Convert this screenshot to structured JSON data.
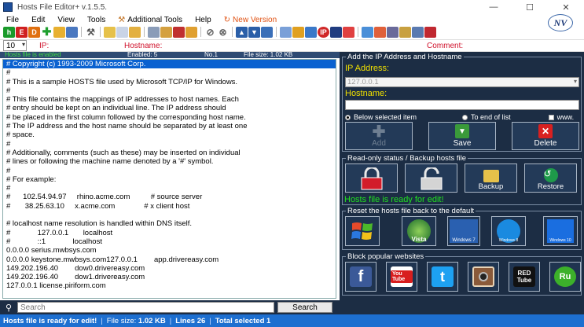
{
  "window": {
    "title": "Hosts File Editor+ v.1.5.5.",
    "logo_text": "NV"
  },
  "menu": {
    "items": [
      "File",
      "Edit",
      "View",
      "Tools"
    ],
    "additional_tools": "Additional Tools",
    "help": "Help",
    "new_version": "New Version"
  },
  "toolbar": {
    "badges": [
      "h",
      "E",
      "D"
    ]
  },
  "filter": {
    "count": "10",
    "ip_label": "IP:",
    "hostname_label": "Hostname:",
    "comment_label": "Comment:"
  },
  "editor_status": {
    "state": "Hosts file is enabled",
    "enabled": "Enabled: 5",
    "line": "No.1",
    "size": "File size: 1.02 KB"
  },
  "editor": {
    "lines": [
      "# Copyright (c) 1993-2009 Microsoft Corp.",
      "#",
      "# This is a sample HOSTS file used by Microsoft TCP/IP for Windows.",
      "#",
      "# This file contains the mappings of IP addresses to host names. Each",
      "# entry should be kept on an individual line. The IP address should",
      "# be placed in the first column followed by the corresponding host name.",
      "# The IP address and the host name should be separated by at least one",
      "# space.",
      "#",
      "# Additionally, comments (such as these) may be inserted on individual",
      "# lines or following the machine name denoted by a '#' symbol.",
      "#",
      "# For example:",
      "#",
      "#      102.54.94.97     rhino.acme.com          # source server",
      "#       38.25.63.10     x.acme.com              # x client host",
      "",
      "# localhost name resolution is handled within DNS itself.",
      "#             127.0.0.1       localhost",
      "#             ::1             localhost",
      "0.0.0.0 serius.mwbsys.com",
      "0.0.0.0 keystone.mwbsys.com127.0.0.1        app.drivereasy.com",
      "149.202.196.40        dow0.drivereasy.com",
      "149.202.196.40        dow1.drivereasy.com",
      "127.0.0.1 license.piriform.com"
    ]
  },
  "search": {
    "placeholder": "Search",
    "button": "Search"
  },
  "add_panel": {
    "title": "Add the IP Address  and Hostname",
    "ip_label": "IP Address:",
    "ip_value": "127.0.0.1",
    "hostname_label": "Hostname:",
    "hostname_value": "",
    "radio_below": "Below selected item",
    "radio_end": "To end of list",
    "checkbox_www": "www.",
    "add_button": "Add",
    "save_button": "Save",
    "delete_button": "Delete"
  },
  "readonly_panel": {
    "title": "Read-only status / Backup hosts file",
    "backup_button": "Backup",
    "restore_button": "Restore",
    "status": "Hosts file is ready for edit!"
  },
  "reset_panel": {
    "title": "Reset the hosts file back to the default",
    "os_labels": [
      "",
      "Vista",
      "Windows 7",
      "Windows 8",
      "Windows 10"
    ]
  },
  "block_panel": {
    "title": "Block popular websites",
    "sites": [
      "Facebook",
      "YouTube",
      "Twitter",
      "Instagram",
      "RedTube",
      "Rutube"
    ],
    "site_labels": [
      "f",
      "You Tube",
      "t",
      "",
      "RED Tube",
      "Ru"
    ]
  },
  "statusbar": {
    "main": "Hosts file is ready for edit!",
    "file_size_label": "File size:",
    "file_size": "1.02 KB",
    "lines_label": "Lines",
    "lines": "26",
    "total_label": "Total selected",
    "total": "1"
  }
}
